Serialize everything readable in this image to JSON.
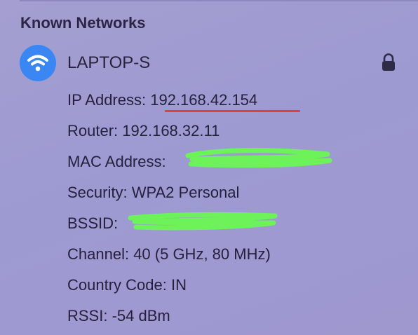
{
  "section": {
    "title": "Known Networks"
  },
  "network": {
    "name": "LAPTOP-S",
    "icon": "wifi-icon",
    "lock_icon": "lock-icon",
    "accent_color": "#3a86f2"
  },
  "details": [
    {
      "label": "IP Address:",
      "value": "192.168.42.154"
    },
    {
      "label": "Router:",
      "value": "192.168.32.11"
    },
    {
      "label": "MAC Address:",
      "value": ""
    },
    {
      "label": "Security:",
      "value": "WPA2 Personal"
    },
    {
      "label": "BSSID:",
      "value": ""
    },
    {
      "label": "Channel:",
      "value": "40 (5 GHz, 80 MHz)"
    },
    {
      "label": "Country Code:",
      "value": "IN"
    },
    {
      "label": "RSSI:",
      "value": "-54 dBm"
    }
  ],
  "annotations": {
    "underline_color": "#d9443a",
    "redaction_color": "#6ef25a"
  }
}
